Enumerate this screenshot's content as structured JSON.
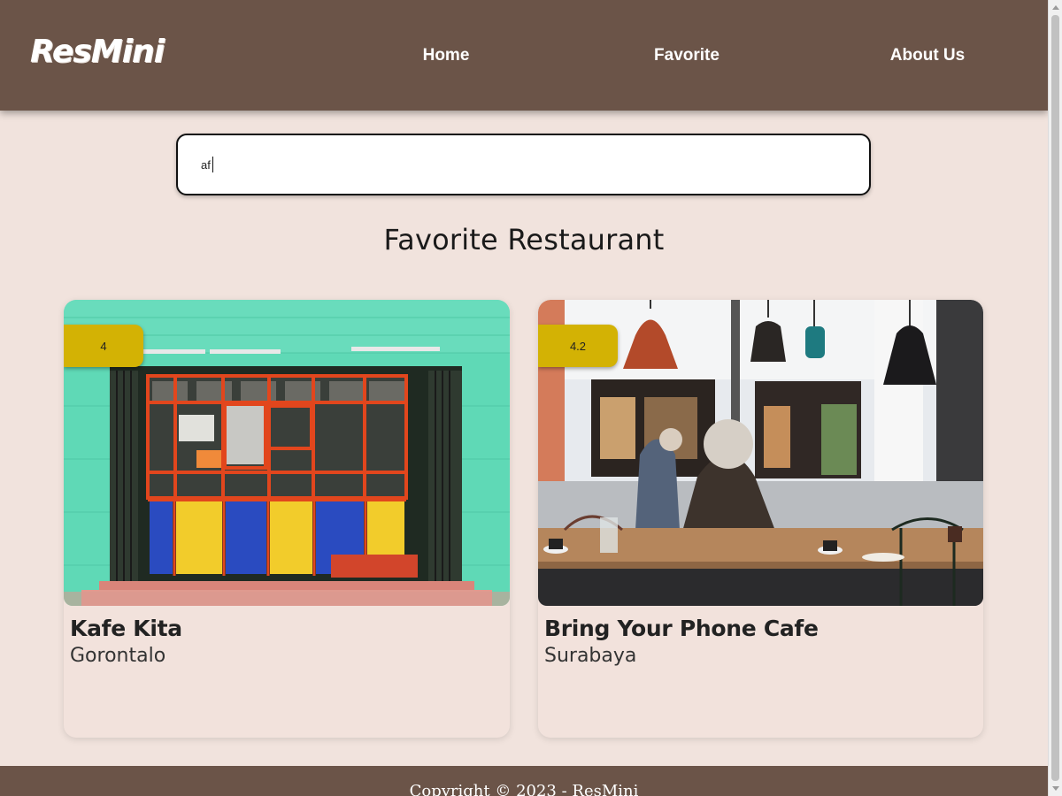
{
  "app": {
    "logo": "ResMini"
  },
  "nav": {
    "items": [
      {
        "label": "Home"
      },
      {
        "label": "Favorite"
      },
      {
        "label": "About Us"
      }
    ]
  },
  "search": {
    "value": "af",
    "placeholder": ""
  },
  "main": {
    "title": "Favorite Restaurant",
    "restaurants": [
      {
        "name": "Kafe Kita",
        "city": "Gorontalo",
        "rating": "4",
        "image": "green storefront with colored window panels"
      },
      {
        "name": "Bring Your Phone Cafe",
        "city": "Surabaya",
        "rating": "4.2",
        "image": "cafe interior with pendant lamps"
      }
    ]
  },
  "footer": {
    "text": "Copyright © 2023 - ResMini"
  },
  "colors": {
    "header": "#6b5448",
    "background": "#f1e3dd",
    "rating_badge": "#d3b204"
  }
}
